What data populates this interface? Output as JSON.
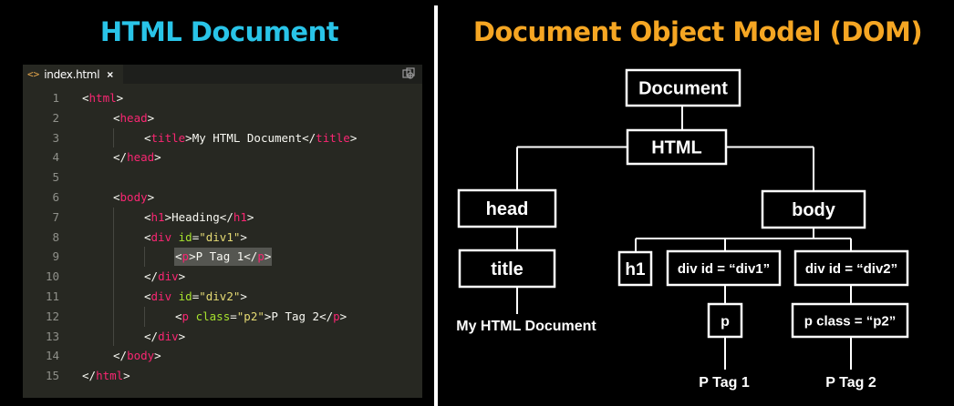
{
  "left_title": "HTML Document",
  "right_title": "Document Object Model (DOM)",
  "editor": {
    "tab_label": "index.html",
    "tab_close": "×",
    "lines": [
      {
        "n": "1",
        "indent": 0,
        "tokens": [
          [
            "p",
            "<"
          ],
          [
            "t",
            "html"
          ],
          [
            "p",
            ">"
          ]
        ]
      },
      {
        "n": "2",
        "indent": 1,
        "tokens": [
          [
            "p",
            "<"
          ],
          [
            "t",
            "head"
          ],
          [
            "p",
            ">"
          ]
        ]
      },
      {
        "n": "3",
        "indent": 2,
        "tokens": [
          [
            "p",
            "<"
          ],
          [
            "t",
            "title"
          ],
          [
            "p",
            ">My HTML Document</"
          ],
          [
            "t",
            "title"
          ],
          [
            "p",
            ">"
          ]
        ]
      },
      {
        "n": "4",
        "indent": 1,
        "tokens": [
          [
            "p",
            "</"
          ],
          [
            "t",
            "head"
          ],
          [
            "p",
            ">"
          ]
        ]
      },
      {
        "n": "5",
        "indent": 0,
        "tokens": []
      },
      {
        "n": "6",
        "indent": 1,
        "tokens": [
          [
            "p",
            "<"
          ],
          [
            "t",
            "body"
          ],
          [
            "p",
            ">"
          ]
        ]
      },
      {
        "n": "7",
        "indent": 2,
        "tokens": [
          [
            "p",
            "<"
          ],
          [
            "t",
            "h1"
          ],
          [
            "p",
            ">Heading</"
          ],
          [
            "t",
            "h1"
          ],
          [
            "p",
            ">"
          ]
        ]
      },
      {
        "n": "8",
        "indent": 2,
        "tokens": [
          [
            "p",
            "<"
          ],
          [
            "t",
            "div"
          ],
          [
            "p",
            " "
          ],
          [
            "a",
            "id"
          ],
          [
            "p",
            "="
          ],
          [
            "s",
            "\"div1\""
          ],
          [
            "p",
            ">"
          ]
        ]
      },
      {
        "n": "9",
        "indent": 3,
        "tokens": [
          [
            "p",
            "<"
          ],
          [
            "t",
            "p"
          ],
          [
            "p",
            ">P Tag 1</"
          ],
          [
            "t",
            "p"
          ],
          [
            "p",
            ">"
          ]
        ],
        "selected": true
      },
      {
        "n": "10",
        "indent": 2,
        "tokens": [
          [
            "p",
            "</"
          ],
          [
            "t",
            "div"
          ],
          [
            "p",
            ">"
          ]
        ]
      },
      {
        "n": "11",
        "indent": 2,
        "tokens": [
          [
            "p",
            "<"
          ],
          [
            "t",
            "div"
          ],
          [
            "p",
            " "
          ],
          [
            "a",
            "id"
          ],
          [
            "p",
            "="
          ],
          [
            "s",
            "\"div2\""
          ],
          [
            "p",
            ">"
          ]
        ]
      },
      {
        "n": "12",
        "indent": 3,
        "tokens": [
          [
            "p",
            "<"
          ],
          [
            "t",
            "p"
          ],
          [
            "p",
            " "
          ],
          [
            "a",
            "class"
          ],
          [
            "p",
            "="
          ],
          [
            "s",
            "\"p2\""
          ],
          [
            "p",
            ">P Tag 2</"
          ],
          [
            "t",
            "p"
          ],
          [
            "p",
            ">"
          ]
        ]
      },
      {
        "n": "13",
        "indent": 2,
        "tokens": [
          [
            "p",
            "</"
          ],
          [
            "t",
            "div"
          ],
          [
            "p",
            ">"
          ]
        ]
      },
      {
        "n": "14",
        "indent": 1,
        "tokens": [
          [
            "p",
            "</"
          ],
          [
            "t",
            "body"
          ],
          [
            "p",
            ">"
          ]
        ]
      },
      {
        "n": "15",
        "indent": 0,
        "tokens": [
          [
            "p",
            "</"
          ],
          [
            "t",
            "html"
          ],
          [
            "p",
            ">"
          ]
        ]
      }
    ]
  },
  "dom": {
    "nodes": [
      {
        "id": "document",
        "label": "Document"
      },
      {
        "id": "html",
        "label": "HTML"
      },
      {
        "id": "head",
        "label": "head"
      },
      {
        "id": "body",
        "label": "body"
      },
      {
        "id": "title",
        "label": "title"
      },
      {
        "id": "h1",
        "label": "h1"
      },
      {
        "id": "div1",
        "label": "div id = “div1”"
      },
      {
        "id": "div2",
        "label": "div id = “div2”"
      },
      {
        "id": "p1",
        "label": "p"
      },
      {
        "id": "p2",
        "label": "p class = “p2”"
      }
    ],
    "leaves": [
      {
        "id": "title-text",
        "label": "My HTML Document"
      },
      {
        "id": "p1-text",
        "label": "P Tag 1"
      },
      {
        "id": "p2-text",
        "label": "P Tag 2"
      }
    ]
  },
  "colors": {
    "left_title": "#29c4e8",
    "right_title": "#f5a623",
    "tag": "#f92672",
    "attr": "#a6e22e",
    "string": "#e6db74"
  }
}
